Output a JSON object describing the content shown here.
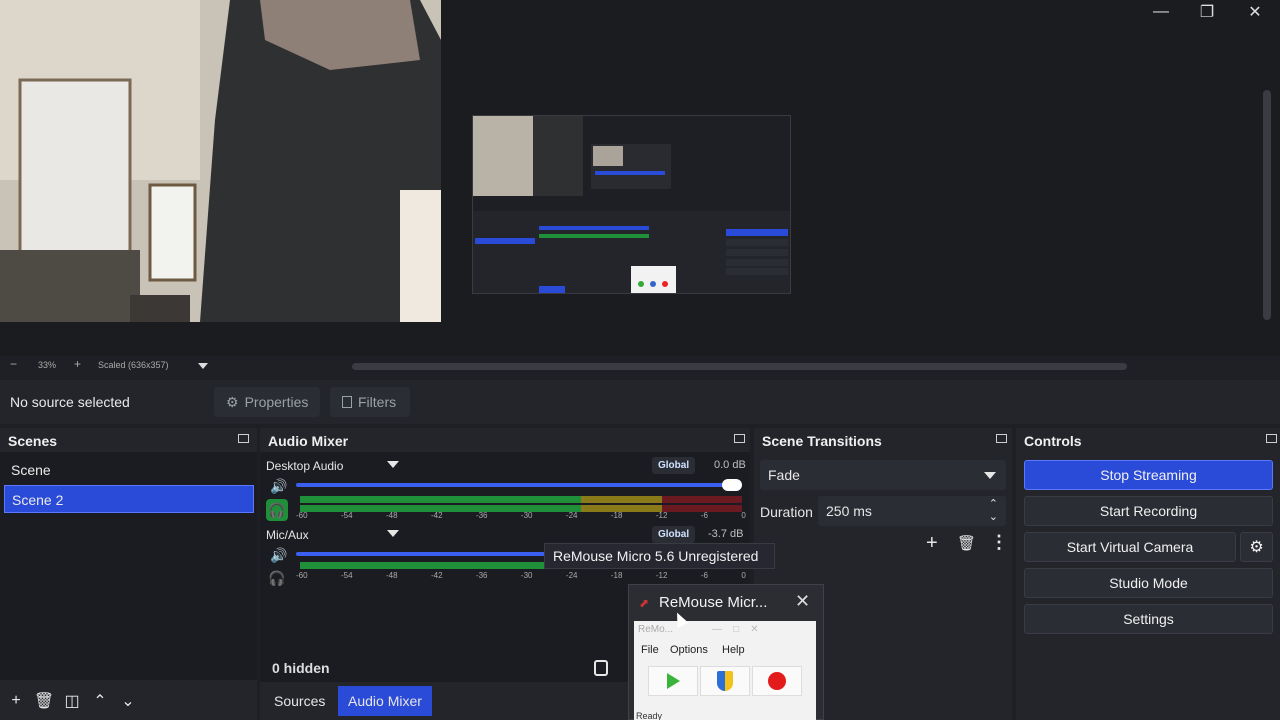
{
  "window": {
    "minimize_icon": "minimize-icon",
    "maximize_icon": "restore-icon",
    "close_icon": "close-icon"
  },
  "zoom": {
    "minus": "−",
    "level": "33%",
    "plus": "+",
    "mode": "Scaled (636x357)"
  },
  "context": {
    "no_source": "No source selected",
    "properties": "Properties",
    "filters": "Filters"
  },
  "scenes": {
    "title": "Scenes",
    "items": [
      {
        "label": "Scene",
        "active": false
      },
      {
        "label": "Scene 2",
        "active": true
      }
    ]
  },
  "mixer": {
    "title": "Audio Mixer",
    "tracks": [
      {
        "name": "Desktop Audio",
        "badge": "Global",
        "db": "0.0 dB",
        "volume": 1.0
      },
      {
        "name": "Mic/Aux",
        "badge": "Global",
        "db": "-3.7 dB",
        "volume": 0.55
      }
    ],
    "ticks": [
      "-60",
      "-54",
      "-48",
      "-42",
      "-36",
      "-30",
      "-24",
      "-18",
      "-12",
      "-6",
      "0"
    ],
    "hidden": "0 hidden"
  },
  "tabs": [
    {
      "label": "Sources",
      "active": false
    },
    {
      "label": "Audio Mixer",
      "active": true
    }
  ],
  "transitions": {
    "title": "Scene Transitions",
    "selected": "Fade",
    "duration_label": "Duration",
    "duration_value": "250 ms"
  },
  "controls": {
    "title": "Controls",
    "stop_streaming": "Stop Streaming",
    "start_recording": "Start Recording",
    "start_virtual_camera": "Start Virtual Camera",
    "studio_mode": "Studio Mode",
    "settings": "Settings"
  },
  "tooltip": "ReMouse Micro 5.6 Unregistered",
  "popup": {
    "title": "ReMouse Micr...",
    "mini_title": "ReMo...",
    "menu": [
      "File",
      "Options",
      "Help"
    ],
    "status": "Ready"
  },
  "colors": {
    "accent": "#2a4bd7",
    "meter_green": "#1f8f3a",
    "meter_yellow": "#8a7a1a",
    "meter_red": "#6b1a22"
  }
}
